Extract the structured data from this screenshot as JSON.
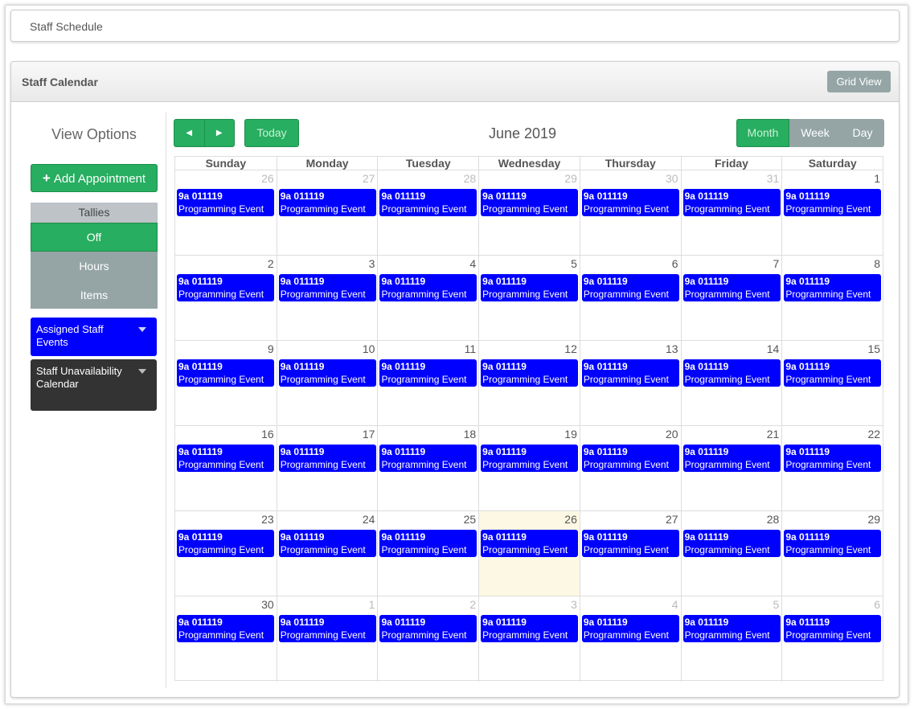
{
  "breadcrumb": "Staff Schedule",
  "panel": {
    "title": "Staff Calendar",
    "grid_view_label": "Grid View"
  },
  "sidebar": {
    "view_options": "View Options",
    "add_appointment": "Add Appointment",
    "tallies": {
      "header": "Tallies",
      "options": [
        "Off",
        "Hours",
        "Items"
      ],
      "selected": "Off"
    },
    "assigned_staff_events": "Assigned Staff Events",
    "staff_unavailability": "Staff Unavailability Calendar"
  },
  "toolbar": {
    "prev_label": "◀",
    "next_label": "▶",
    "today_label": "Today",
    "month_title": "June 2019",
    "views": [
      "Month",
      "Week",
      "Day"
    ],
    "active_view": "Month"
  },
  "calendar": {
    "weekdays": [
      "Sunday",
      "Monday",
      "Tuesday",
      "Wednesday",
      "Thursday",
      "Friday",
      "Saturday"
    ],
    "today": "26",
    "weeks": [
      [
        {
          "d": "26",
          "other": true
        },
        {
          "d": "27",
          "other": true
        },
        {
          "d": "28",
          "other": true
        },
        {
          "d": "29",
          "other": true
        },
        {
          "d": "30",
          "other": true
        },
        {
          "d": "31",
          "other": true
        },
        {
          "d": "1"
        }
      ],
      [
        {
          "d": "2"
        },
        {
          "d": "3"
        },
        {
          "d": "4"
        },
        {
          "d": "5"
        },
        {
          "d": "6"
        },
        {
          "d": "7"
        },
        {
          "d": "8"
        }
      ],
      [
        {
          "d": "9"
        },
        {
          "d": "10"
        },
        {
          "d": "11"
        },
        {
          "d": "12"
        },
        {
          "d": "13"
        },
        {
          "d": "14"
        },
        {
          "d": "15"
        }
      ],
      [
        {
          "d": "16"
        },
        {
          "d": "17"
        },
        {
          "d": "18"
        },
        {
          "d": "19"
        },
        {
          "d": "20"
        },
        {
          "d": "21"
        },
        {
          "d": "22"
        }
      ],
      [
        {
          "d": "23"
        },
        {
          "d": "24"
        },
        {
          "d": "25"
        },
        {
          "d": "26",
          "today": true
        },
        {
          "d": "27"
        },
        {
          "d": "28"
        },
        {
          "d": "29"
        }
      ],
      [
        {
          "d": "30"
        },
        {
          "d": "1",
          "other": true
        },
        {
          "d": "2",
          "other": true
        },
        {
          "d": "3",
          "other": true
        },
        {
          "d": "4",
          "other": true
        },
        {
          "d": "5",
          "other": true
        },
        {
          "d": "6",
          "other": true
        }
      ]
    ],
    "event": {
      "time": "9a",
      "code": "011119",
      "name": "Programming Event",
      "color": "#0000ff"
    }
  },
  "colors": {
    "accent_green": "#27ae60",
    "muted_gray": "#95a5a6",
    "event_blue": "#0000ff",
    "today_bg": "#fcf8e3"
  }
}
